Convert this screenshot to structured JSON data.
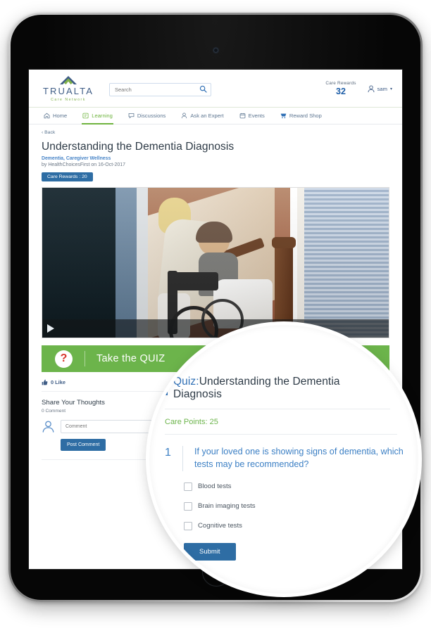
{
  "device": {
    "type": "tablet",
    "camera": "camera-dot",
    "home_button": "home-button"
  },
  "header": {
    "logo": {
      "word": "TRUALTA",
      "sub": "Care  Network",
      "mark": "mountain-icon",
      "colors": {
        "blue": "#3f5d86",
        "green": "#7fb04a"
      }
    },
    "search": {
      "placeholder": "Search",
      "value": "",
      "icon": "search-icon"
    },
    "rewards": {
      "label": "Care Rewards",
      "value": "32"
    },
    "user": {
      "name": "sam",
      "icon": "user-icon",
      "caret": "▾"
    }
  },
  "nav": {
    "items": [
      {
        "label": "Home",
        "icon": "home-icon",
        "active": false
      },
      {
        "label": "Learning",
        "icon": "learning-icon",
        "active": true
      },
      {
        "label": "Discussions",
        "icon": "discussions-icon",
        "active": false
      },
      {
        "label": "Ask an Expert",
        "icon": "expert-icon",
        "active": false
      },
      {
        "label": "Events",
        "icon": "calendar-icon",
        "active": false
      },
      {
        "label": "Reward Shop",
        "icon": "cart-icon",
        "active": false
      }
    ],
    "active_color": "#6fb43f"
  },
  "article": {
    "back_label": "‹ Back",
    "title": "Understanding the Dementia Diagnosis",
    "tags": "Dementia, Caregiver Wellness",
    "byline": "by HealthChoicesFirst on 16-Oct-2017",
    "reward_badge": "Care Rewards : 20"
  },
  "video": {
    "play_icon": "play-icon",
    "description": "caregiver-with-seated-woman-in-wheelchair"
  },
  "quiz_cta": {
    "icon": "question-mark-icon",
    "label": "Take the QUIZ",
    "color": "#6cb44b"
  },
  "social": {
    "like_icon": "thumbs-up-icon",
    "like_text": "0 Like",
    "share_title": "Share Your Thoughts",
    "comment_count": "0 Comment",
    "avatar_icon": "user-avatar-icon",
    "comment_placeholder": "Comment",
    "comment_value": "",
    "post_button": "Post Comment"
  },
  "quiz_modal": {
    "title_prefix": "Quiz:",
    "title": "Understanding the Dementia Diagnosis",
    "care_points": "Care Points: 25",
    "question_number": "1",
    "question_text": "If your loved one is showing signs of dementia, which tests may be recommended?",
    "options": [
      {
        "label": "Blood tests",
        "checked": false
      },
      {
        "label": "Brain imaging tests",
        "checked": false
      },
      {
        "label": "Cognitive tests",
        "checked": false
      }
    ],
    "submit_label": "Submit",
    "accent_blue": "#2f6fb5",
    "accent_green": "#6cb44b"
  }
}
